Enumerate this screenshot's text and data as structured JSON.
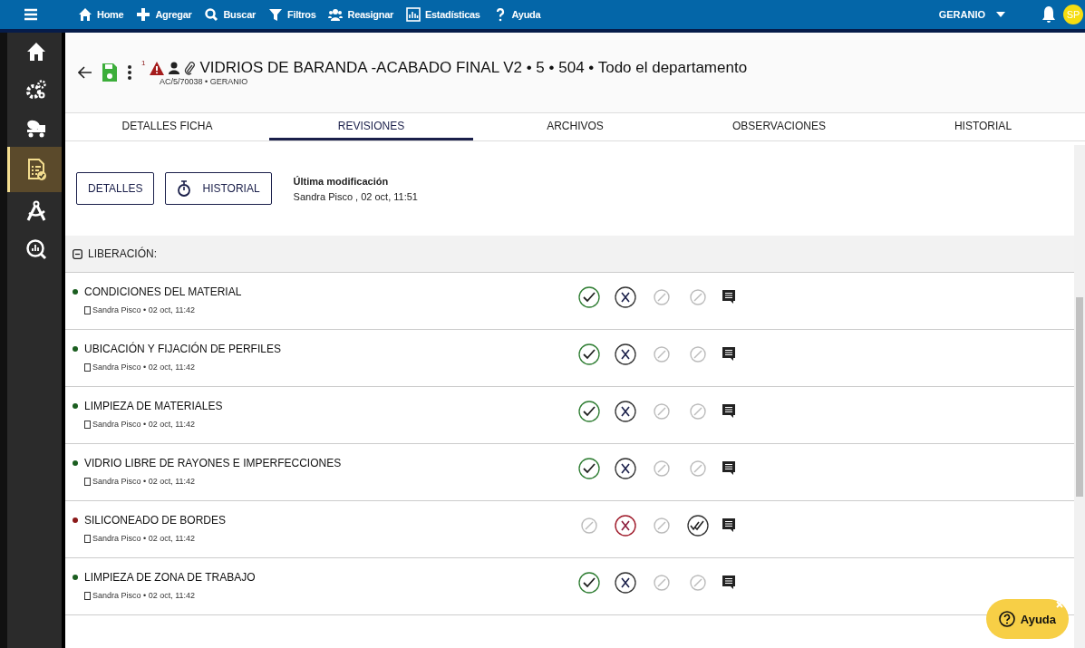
{
  "topbar": {
    "menu": [
      {
        "label": "Home"
      },
      {
        "label": "Agregar"
      },
      {
        "label": "Buscar"
      },
      {
        "label": "Filtros"
      },
      {
        "label": "Reasignar"
      },
      {
        "label": "Estadísticas"
      },
      {
        "label": "Ayuda"
      }
    ],
    "project": "GERANIO",
    "avatar": "SP"
  },
  "sidebar": {
    "items": [
      {
        "selected": false
      },
      {
        "selected": false
      },
      {
        "selected": false
      },
      {
        "selected": true
      },
      {
        "selected": false
      },
      {
        "selected": false
      }
    ]
  },
  "header": {
    "alert_count": "1",
    "title": "VIDRIOS DE BARANDA -ACABADO FINAL V2 • 5 • 504 • Todo el departamento",
    "subtitle": "AC/5/70038 • GERANIO"
  },
  "tabs": [
    {
      "label": "DETALLES FICHA",
      "selected": false
    },
    {
      "label": "REVISIONES",
      "selected": true
    },
    {
      "label": "ARCHIVOS",
      "selected": false
    },
    {
      "label": "OBSERVACIONES",
      "selected": false
    },
    {
      "label": "HISTORIAL",
      "selected": false
    }
  ],
  "actions": {
    "details_button": "DETALLES",
    "history_button": "HISTORIAL",
    "last_modified_label": "Última modificación",
    "last_modified_value": "Sandra Pisco , 02 oct, 11:51"
  },
  "section": {
    "title": "LIBERACIÓN:",
    "expanded": true,
    "items": [
      {
        "title": "CONDICIONES DEL MATERIAL",
        "meta": "Sandra Pisco • 02 oct, 11:42",
        "color": "#1b5e20",
        "kind": "approved"
      },
      {
        "title": "UBICACIÓN Y FIJACIÓN DE PERFILES",
        "meta": "Sandra Pisco • 02 oct, 11:42",
        "color": "#1b5e20",
        "kind": "approved"
      },
      {
        "title": "LIMPIEZA DE MATERIALES",
        "meta": "Sandra Pisco • 02 oct, 11:42",
        "color": "#1b5e20",
        "kind": "approved"
      },
      {
        "title": "VIDRIO LIBRE DE RAYONES E IMPERFECCIONES",
        "meta": "Sandra Pisco • 02 oct, 11:42",
        "color": "#1b5e20",
        "kind": "approved"
      },
      {
        "title": "SILICONEADO DE BORDES",
        "meta": "Sandra Pisco • 02 oct, 11:42",
        "color": "#8b1a1a",
        "kind": "rejected"
      },
      {
        "title": "LIMPIEZA DE ZONA DE TRABAJO",
        "meta": "Sandra Pisco • 02 oct, 11:42",
        "color": "#1b5e20",
        "kind": "approved"
      }
    ]
  },
  "help_button": {
    "label": "Ayuda"
  }
}
